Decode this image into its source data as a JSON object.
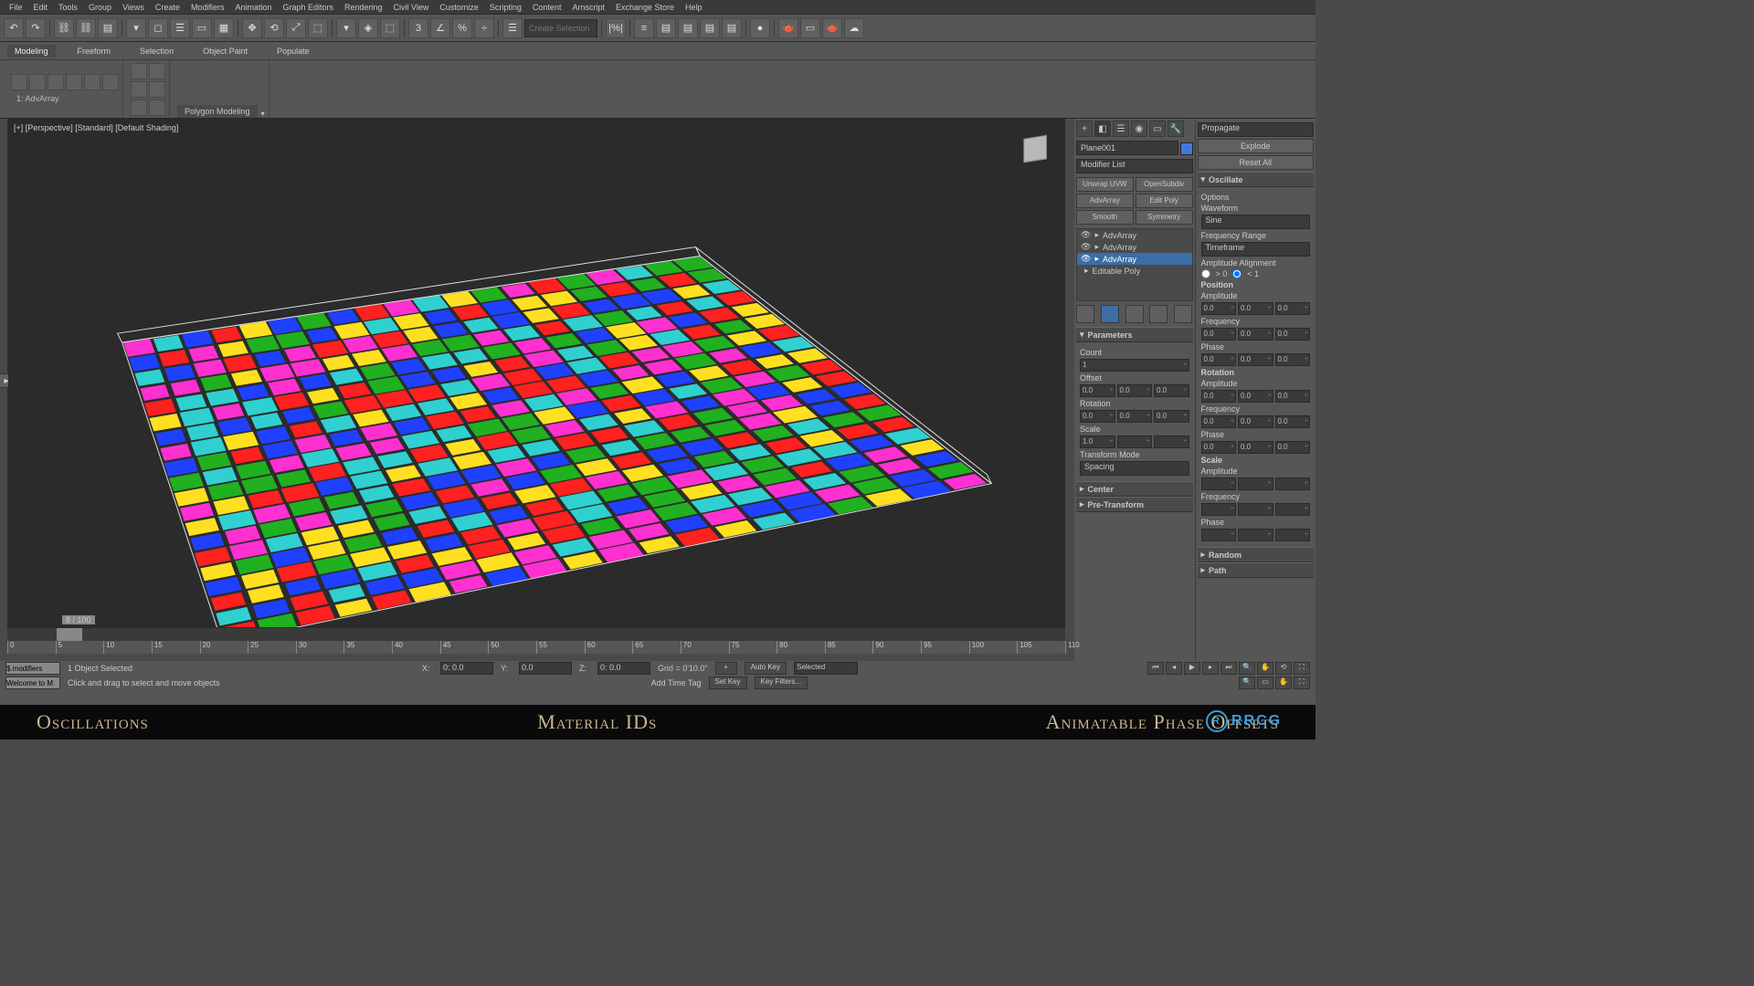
{
  "menubar": [
    "File",
    "Edit",
    "Tools",
    "Group",
    "Views",
    "Create",
    "Modifiers",
    "Animation",
    "Graph Editors",
    "Rendering",
    "Civil View",
    "Customize",
    "Scripting",
    "Content",
    "Arnscript",
    "Exchange Store",
    "Help"
  ],
  "toolbar": {
    "selection_set_placeholder": "Create Selection Se"
  },
  "ribbon": {
    "tabs": [
      "Modeling",
      "Freeform",
      "Selection",
      "Object Paint",
      "Populate"
    ],
    "active": 0,
    "subgroup_label": "Polygon Modeling",
    "advarray_label": "1: AdvArray"
  },
  "viewport": {
    "label": "[+] [Perspective] [Standard] [Default Shading]"
  },
  "modifier_panel": {
    "object_name": "Plane001",
    "modifier_list": "Modifier List",
    "mod_buttons": [
      "Unwrap UVW",
      "OpenSubdiv",
      "AdvArray",
      "Edit Poly",
      "Smooth",
      "Symmetry"
    ],
    "stack": [
      {
        "name": "AdvArray",
        "sel": false
      },
      {
        "name": "AdvArray",
        "sel": false
      },
      {
        "name": "AdvArray",
        "sel": true
      },
      {
        "name": "Editable Poly",
        "sel": false
      }
    ],
    "rollouts": {
      "parameters": "Parameters",
      "center": "Center",
      "pretransform": "Pre-Transform"
    },
    "params": {
      "count_label": "Count",
      "count": "1",
      "offset_label": "Offset",
      "offset": [
        "0.0",
        "0.0",
        "0.0"
      ],
      "rotation_label": "Rotation",
      "rotation": [
        "0.0",
        "0.0",
        "0.0"
      ],
      "scale_label": "Scale",
      "scale": [
        "1.0",
        "",
        "",
        ""
      ],
      "transform_mode": "Transform Mode",
      "transform_val": "Spacing"
    }
  },
  "right_panel": {
    "propagate": "Propagate",
    "explode": "Explode",
    "reset": "Reset All",
    "oscillate": "Oscillate",
    "options": "Options",
    "waveform": "Waveform",
    "waveform_val": "Sine",
    "freq_range": "Frequency Range",
    "freq_range_val": "Timeframe",
    "amp_align": "Amplitude Alignment",
    "aa_lo": "> 0",
    "aa_hi": "< 1",
    "position": "Position",
    "amplitude": "Amplitude",
    "amp_vals": [
      "0.0",
      "0.0",
      "0.0"
    ],
    "frequency": "Frequency",
    "freq_vals": [
      "0.0",
      "0.0",
      "0.0"
    ],
    "phase": "Phase",
    "phase_vals": [
      "0.0",
      "0.0",
      "0.0"
    ],
    "rotation": "Rotation",
    "r_amp": [
      "0.0",
      "0.0",
      "0.0"
    ],
    "r_freq": [
      "0.0",
      "0.0",
      "0.0"
    ],
    "r_phase": [
      "0.0",
      "0.0",
      "0.0"
    ],
    "scale_h": "Scale",
    "s_amp": [
      "",
      "",
      ""
    ],
    "s_freq": [
      "",
      "",
      ""
    ],
    "s_phase": [
      "",
      "",
      ""
    ],
    "random": "Random",
    "path": "Path"
  },
  "timeline": {
    "current": "8 / 100",
    "ticks": [
      0,
      5,
      10,
      15,
      20,
      25,
      30,
      35,
      40,
      45,
      50,
      55,
      60,
      65,
      70,
      75,
      80,
      85,
      90,
      95,
      100,
      105,
      110
    ]
  },
  "status": {
    "script_input": "$.modifiers",
    "welcome": "Welcome to M",
    "sel": "1 Object Selected",
    "prompt": "Click and drag to select and move objects",
    "x": "0: 0.0",
    "y": "0.0",
    "z": "0: 0.0",
    "grid": "Grid = 0'10.0\"",
    "add_time_tag": "Add Time Tag",
    "auto_key": "Auto Key",
    "set_key": "Set Key",
    "selected": "Selected",
    "key_filters": "Key Filters..."
  },
  "caption": {
    "left": "Oscillations",
    "mid": "Material IDs",
    "right": "Animatable Phase Offsets"
  },
  "watermark": "RRCG"
}
